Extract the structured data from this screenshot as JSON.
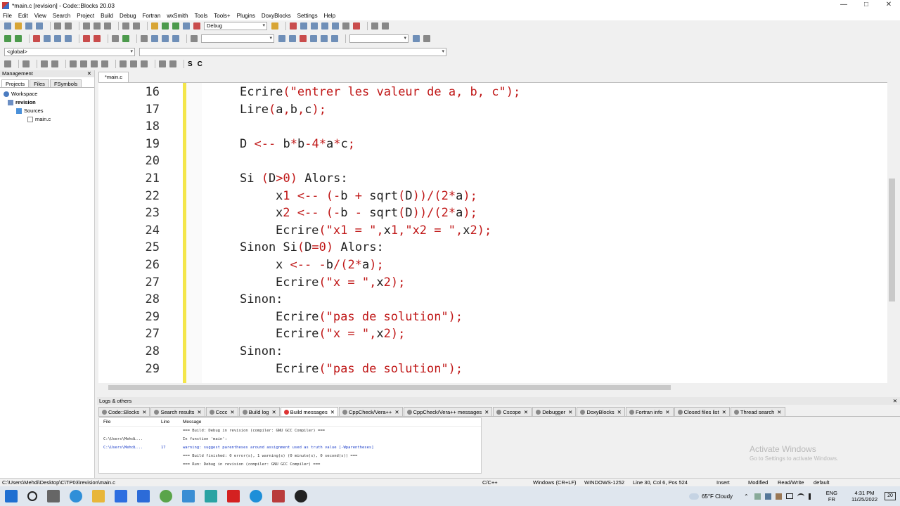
{
  "window": {
    "title": "*main.c [revision] - Code::Blocks 20.03"
  },
  "menu": [
    "File",
    "Edit",
    "View",
    "Search",
    "Project",
    "Build",
    "Debug",
    "Fortran",
    "wxSmith",
    "Tools",
    "Tools+",
    "Plugins",
    "DoxyBlocks",
    "Settings",
    "Help"
  ],
  "toolbar": {
    "build_target": "Debug",
    "scope": "<global>"
  },
  "toolbar_text": {
    "s": "S",
    "c": "C"
  },
  "management": {
    "title": "Management",
    "tabs": [
      "Projects",
      "Files",
      "FSymbols"
    ],
    "tree": {
      "workspace": "Workspace",
      "project": "revision",
      "folder": "Sources",
      "file": "main.c"
    }
  },
  "editor": {
    "tab": "*main.c",
    "lines": [
      {
        "n": "16",
        "code": "Ecrire(\"entrer les valeur de a, b, c\");",
        "indent": 1
      },
      {
        "n": "17",
        "code": "Lire(a,b,c);",
        "indent": 1
      },
      {
        "n": "18",
        "code": "",
        "indent": 1
      },
      {
        "n": "19",
        "code": "D <-- b*b-4*a*c;",
        "indent": 1
      },
      {
        "n": "20",
        "code": "",
        "indent": 1
      },
      {
        "n": "21",
        "code": "Si (D>0) Alors:",
        "indent": 1
      },
      {
        "n": "22",
        "code": "x1 <-- (-b + sqrt(D))/(2*a);",
        "indent": 2
      },
      {
        "n": "23",
        "code": "x2 <-- (-b - sqrt(D))/(2*a);",
        "indent": 2
      },
      {
        "n": "24",
        "code": "Ecrire(\"x1 = \",x1,\"x2 = \",x2);",
        "indent": 2
      },
      {
        "n": "25",
        "code": "Sinon Si(D=0) Alors:",
        "indent": 1
      },
      {
        "n": "26",
        "code": "x <-- -b/(2*a);",
        "indent": 2
      },
      {
        "n": "27",
        "code": "Ecrire(\"x = \",x2);",
        "indent": 2
      },
      {
        "n": "28",
        "code": "Sinon:",
        "indent": 1
      },
      {
        "n": "29",
        "code": "Ecrire(\"pas de solution\");",
        "indent": 2
      },
      {
        "n": "27",
        "code": "Ecrire(\"x = \",x2);",
        "indent": 2
      },
      {
        "n": "28",
        "code": "Sinon:",
        "indent": 1
      },
      {
        "n": "29",
        "code": "Ecrire(\"pas de solution\");",
        "indent": 2
      }
    ]
  },
  "logs": {
    "title": "Logs & others",
    "tabs": [
      "Code::Blocks",
      "Search results",
      "Cccc",
      "Build log",
      "Build messages",
      "CppCheck/Vera++",
      "CppCheck/Vera++ messages",
      "Cscope",
      "Debugger",
      "DoxyBlocks",
      "Fortran info",
      "Closed files list",
      "Thread search"
    ],
    "columns": [
      "File",
      "Line",
      "Message"
    ],
    "rows": [
      {
        "file": "",
        "line": "",
        "msg": "=== Build: Debug in revision (compiler: GNU GCC Compiler) ===",
        "warn": false
      },
      {
        "file": "C:\\Users\\Mehdi...",
        "line": "",
        "msg": "In function 'main':",
        "warn": false
      },
      {
        "file": "C:\\Users\\Mehdi...",
        "line": "17",
        "msg": "warning: suggest parentheses around assignment used as truth value [-Wparentheses]",
        "warn": true
      },
      {
        "file": "",
        "line": "",
        "msg": "=== Build finished: 0 error(s), 1 warning(s) (0 minute(s), 0 second(s)) ===",
        "warn": false
      },
      {
        "file": "",
        "line": "",
        "msg": "=== Run: Debug in revision (compiler: GNU GCC Compiler) ===",
        "warn": false
      }
    ]
  },
  "watermark": {
    "line1": "Activate Windows",
    "line2": "Go to Settings to activate Windows."
  },
  "status": {
    "path": "C:\\Users\\Mehdi\\Desktop\\C\\TP03\\revision\\main.c",
    "lang": "C/C++",
    "eol": "Windows (CR+LF)",
    "encoding": "WINDOWS-1252",
    "position": "Line 30, Col 6, Pos 524",
    "mode": "Insert",
    "modified": "Modified",
    "access": "Read/Write",
    "profile": "default"
  },
  "taskbar": {
    "weather": "65°F Cloudy",
    "lang1": "ENG",
    "lang2": "FR",
    "time": "4:31 PM",
    "date": "11/25/2022",
    "notif": "20"
  }
}
